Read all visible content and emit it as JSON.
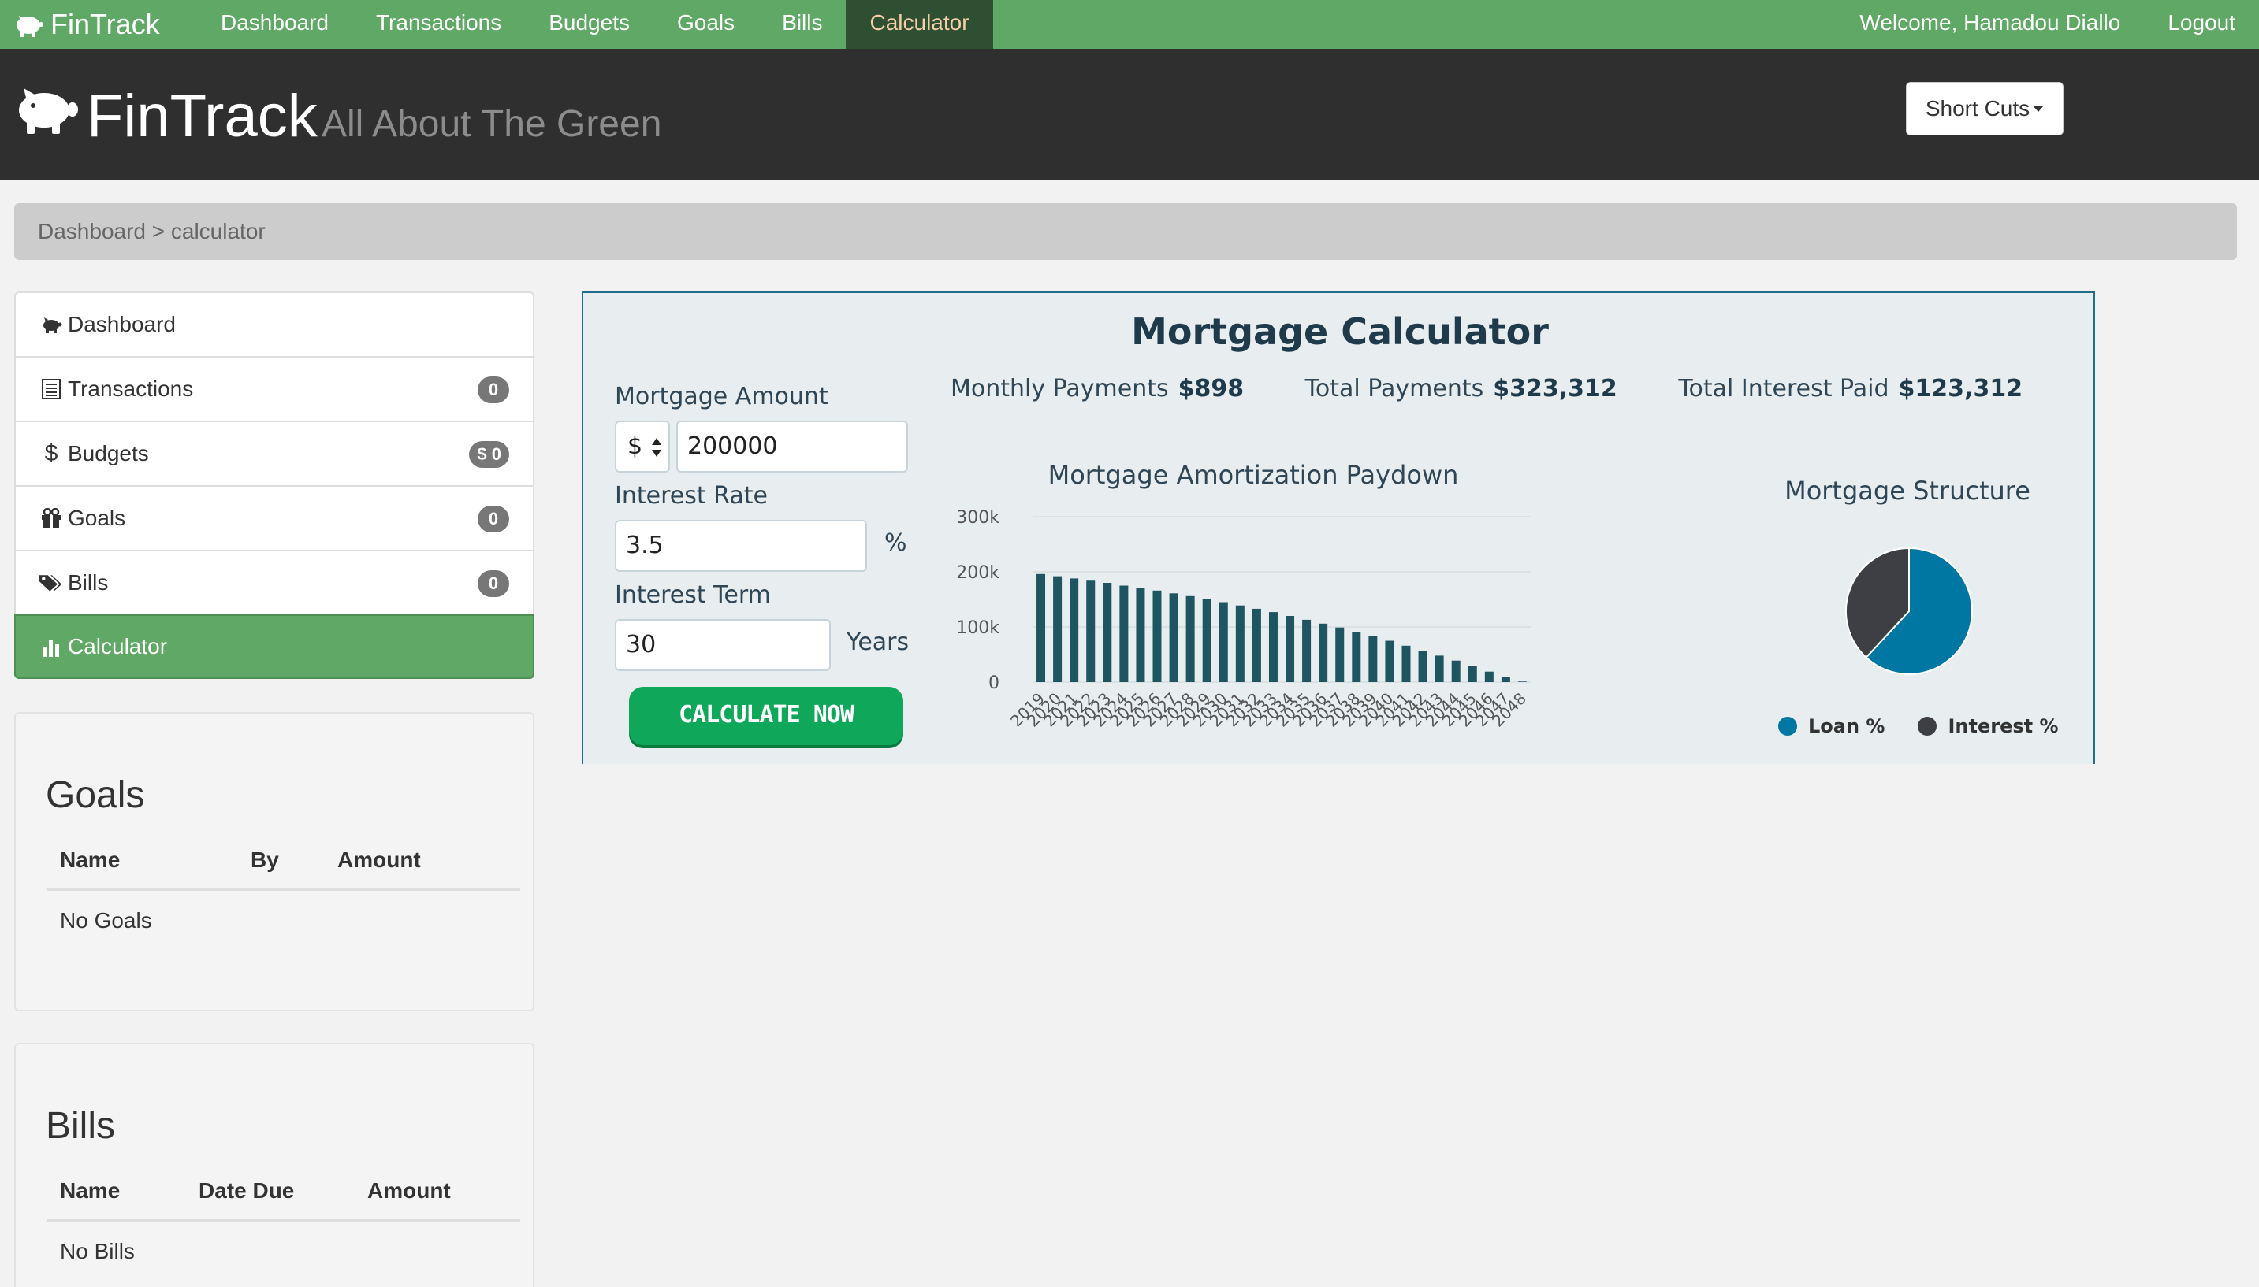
{
  "nav": {
    "brand": "FinTrack",
    "items": [
      "Dashboard",
      "Transactions",
      "Budgets",
      "Goals",
      "Bills",
      "Calculator"
    ],
    "welcome": "Welcome, Hamadou Diallo",
    "logout": "Logout"
  },
  "header": {
    "title": "FinTrack",
    "subtitle": "All About The Green",
    "shortcuts": "Short Cuts"
  },
  "breadcrumb": "Dashboard > calculator",
  "sidebar": {
    "items": [
      {
        "label": "Dashboard",
        "icon": "piggy-bank-icon",
        "badge": ""
      },
      {
        "label": "Transactions",
        "icon": "list-icon",
        "badge": "0"
      },
      {
        "label": "Budgets",
        "icon": "dollar-icon",
        "badge": "$ 0"
      },
      {
        "label": "Goals",
        "icon": "gift-icon",
        "badge": "0"
      },
      {
        "label": "Bills",
        "icon": "tags-icon",
        "badge": "0"
      },
      {
        "label": "Calculator",
        "icon": "bar-chart-icon",
        "badge": ""
      }
    ]
  },
  "goals": {
    "title": "Goals",
    "headers": [
      "Name",
      "By",
      "Amount"
    ],
    "empty": "No Goals"
  },
  "bills": {
    "title": "Bills",
    "headers": [
      "Name",
      "Date Due",
      "Amount"
    ],
    "empty": "No Bills"
  },
  "calculator": {
    "title": "Mortgage Calculator",
    "amount_label": "Mortgage Amount",
    "currency": "$",
    "amount": "200000",
    "rate_label": "Interest Rate",
    "rate": "3.5",
    "rate_unit": "%",
    "term_label": "Interest Term",
    "term": "30",
    "term_unit": "Years",
    "button": "CALCULATE NOW",
    "monthly_label": "Monthly Payments",
    "monthly": "$898",
    "total_label": "Total Payments",
    "total": "$323,312",
    "interest_label": "Total Interest Paid",
    "interest": "$123,312"
  },
  "colors": {
    "nav_green": "#5fa865",
    "bar": "#1f5560",
    "loan": "#0077a3",
    "interest": "#3d3f44",
    "button": "#0fa75a"
  },
  "chart_data": [
    {
      "type": "bar",
      "title": "Mortgage Amortization Paydown",
      "categories": [
        "2019",
        "2020",
        "2021",
        "2022",
        "2023",
        "2024",
        "2025",
        "2026",
        "2027",
        "2028",
        "2029",
        "2030",
        "2031",
        "2032",
        "2033",
        "2034",
        "2035",
        "2036",
        "2037",
        "2038",
        "2039",
        "2040",
        "2041",
        "2042",
        "2043",
        "2044",
        "2045",
        "2046",
        "2047",
        "2048"
      ],
      "values": [
        196000,
        192000,
        188000,
        184000,
        180000,
        175000,
        171000,
        166000,
        161000,
        156000,
        151000,
        145000,
        139000,
        133000,
        127000,
        120000,
        113000,
        106000,
        99000,
        91000,
        83000,
        75000,
        66000,
        57000,
        48000,
        39000,
        29000,
        19000,
        9000,
        1000
      ],
      "y_ticks": [
        "300k",
        "200k",
        "100k",
        "0"
      ],
      "ylim": [
        0,
        300000
      ],
      "grid": true
    },
    {
      "type": "pie",
      "title": "Mortgage Structure",
      "labels": [
        "Loan %",
        "Interest %"
      ],
      "values": [
        61.9,
        38.1
      ],
      "colors": [
        "#0077a3",
        "#3d3f44"
      ],
      "legend": "bottom"
    }
  ]
}
